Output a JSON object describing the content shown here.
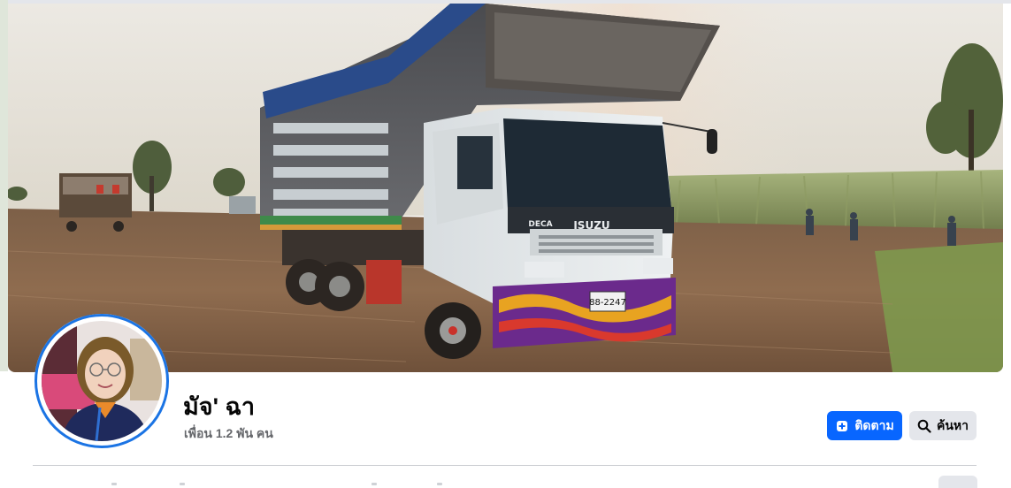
{
  "profile": {
    "name": "มัจ' ฉา",
    "friends_text": "เพื่อน 1.2 พัน คน"
  },
  "actions": {
    "follow_label": "ติดตาม",
    "search_label": "ค้นหา"
  },
  "cover_photo": {
    "truck_plate": "88-2247",
    "truck_brand": "ISUZU",
    "truck_model": "DECA"
  },
  "colors": {
    "accent": "#0866ff",
    "avatar_ring": "#1b74e4",
    "secondary_button": "#e4e6eb",
    "secondary_text": "#65676b"
  }
}
